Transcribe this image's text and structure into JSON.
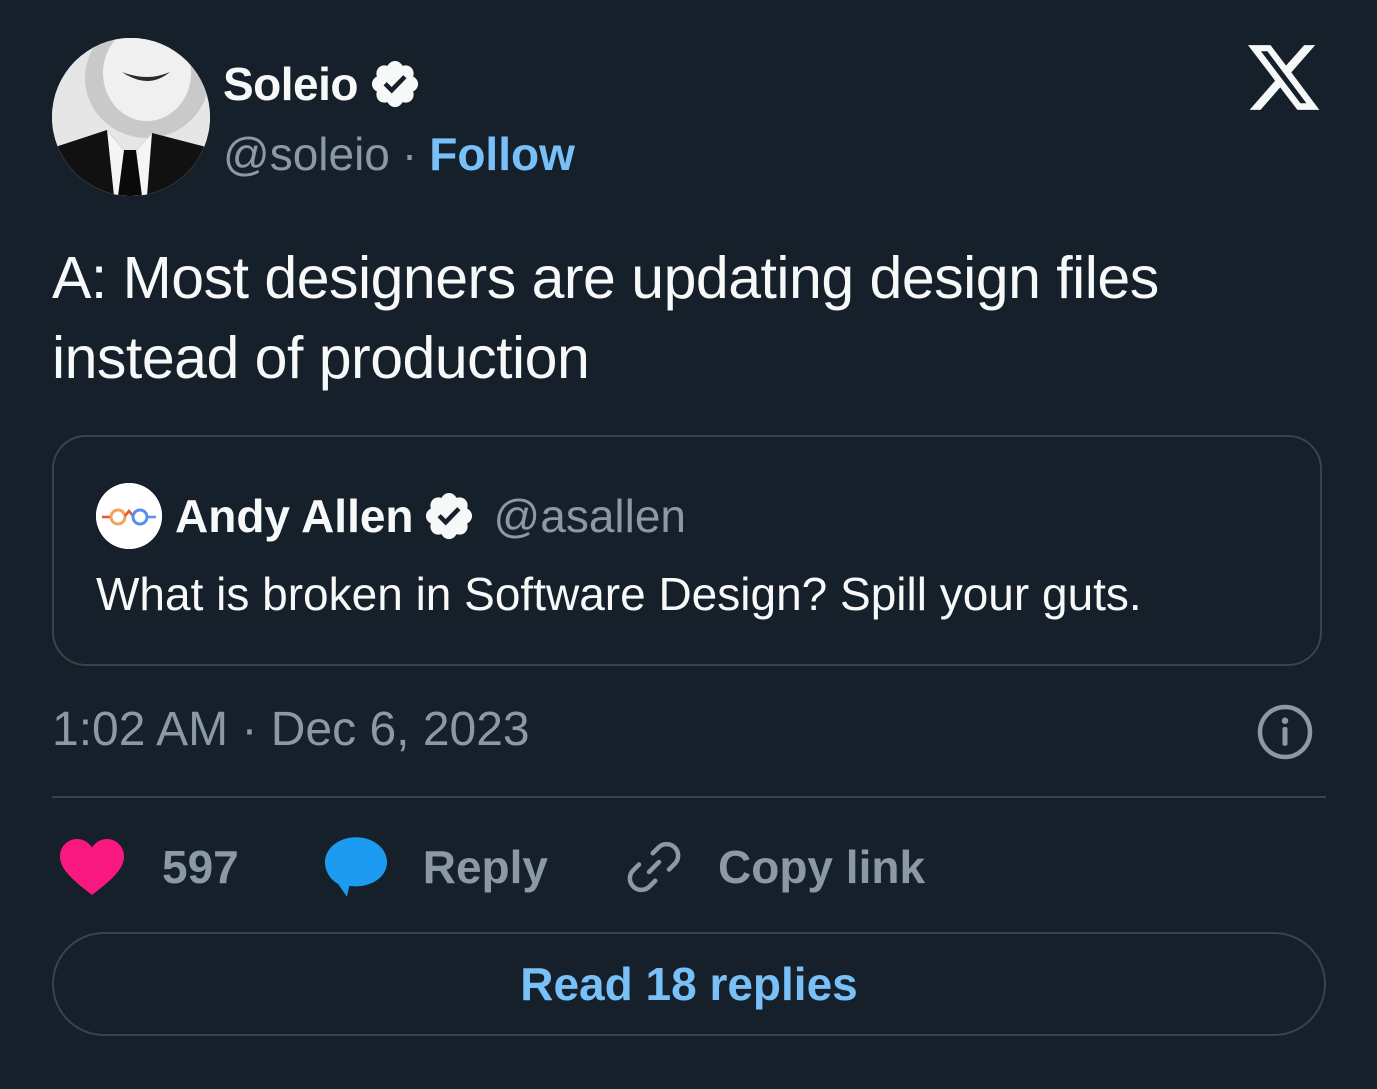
{
  "author": {
    "display_name": "Soleio",
    "handle": "@soleio",
    "separator": "·",
    "follow_label": "Follow",
    "verified": true,
    "avatar_icon": "portrait-photo"
  },
  "platform_icon": "x-logo-icon",
  "tweet": {
    "text": "A: Most designers are updating design files instead of production"
  },
  "quote": {
    "display_name": "Andy Allen",
    "handle": "@asallen",
    "verified": true,
    "text": "What is broken in Software Design? Spill your guts."
  },
  "timestamp": "1:02 AM · Dec 6, 2023",
  "actions": {
    "like_count": "597",
    "reply_label": "Reply",
    "copy_link_label": "Copy link"
  },
  "read_replies_label": "Read 18 replies",
  "colors": {
    "background": "#15202b",
    "accent": "#79c0f9",
    "like": "#f91880",
    "reply": "#1d9bf0",
    "muted": "#8b98a5",
    "border": "#38444d"
  }
}
